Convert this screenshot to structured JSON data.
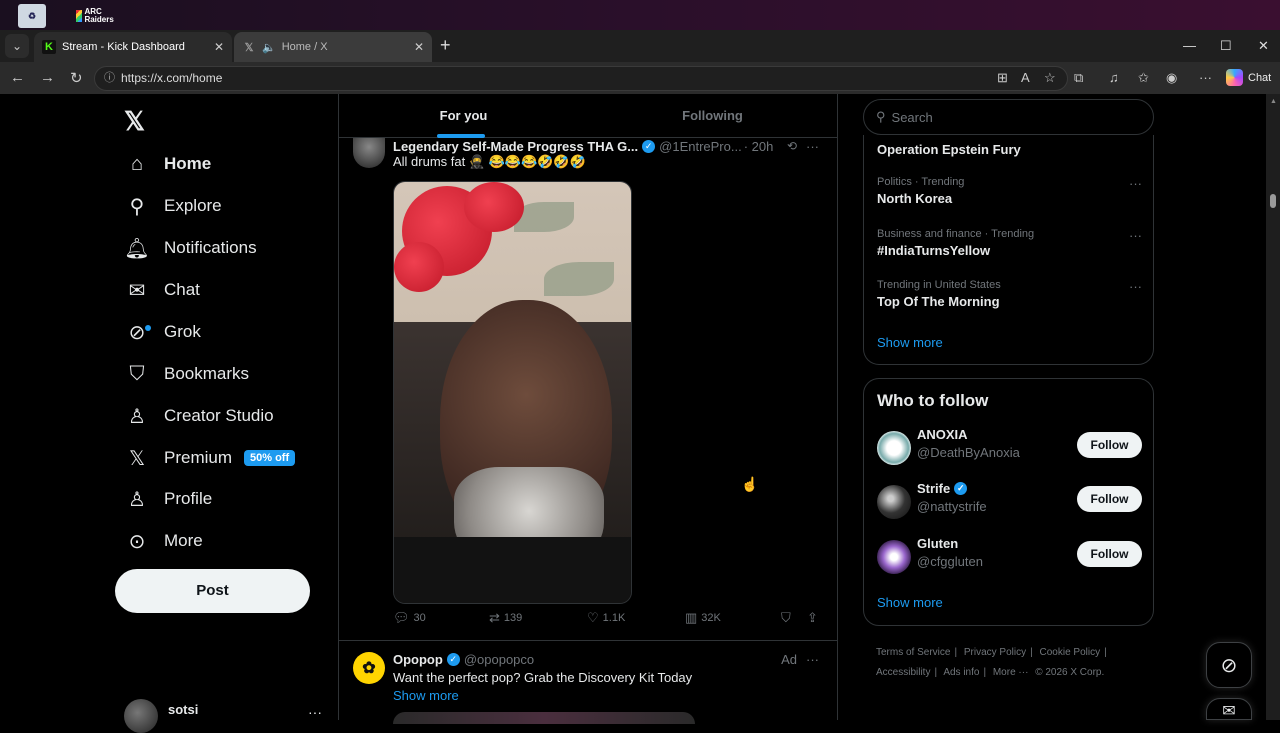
{
  "desktop": {
    "arc_label": "ARC Raiders"
  },
  "browser": {
    "tabs": [
      {
        "title": "Stream - Kick Dashboard",
        "favicon": "kick-icon"
      },
      {
        "title": "Home / X",
        "favicon": "x-icon"
      }
    ],
    "url": "https://x.com/home",
    "copilot_label": "Chat"
  },
  "nav": {
    "items": [
      {
        "label": "Home",
        "icon": "home-icon"
      },
      {
        "label": "Explore",
        "icon": "search-icon"
      },
      {
        "label": "Notifications",
        "icon": "bell-icon"
      },
      {
        "label": "Chat",
        "icon": "mail-icon"
      },
      {
        "label": "Grok",
        "icon": "grok-icon"
      },
      {
        "label": "Bookmarks",
        "icon": "bookmark-icon"
      },
      {
        "label": "Creator Studio",
        "icon": "creator-icon"
      },
      {
        "label": "Premium",
        "icon": "x-icon"
      },
      {
        "label": "Profile",
        "icon": "person-icon"
      },
      {
        "label": "More",
        "icon": "more-circle-icon"
      }
    ],
    "premium_badge": "50% off",
    "post_label": "Post",
    "account_name": "sotsi"
  },
  "feed": {
    "tabs": [
      "For you",
      "Following"
    ],
    "tweet": {
      "name": "Legendary Self-Made Progress THA G...",
      "handle": "@1EntrePro...",
      "time": "· 20h",
      "text": "All drums fat 🥷 😂😂😂🤣🤣🤣",
      "replies": "30",
      "reposts": "139",
      "likes": "1.1K",
      "views": "32K"
    },
    "ad": {
      "name": "Opopop",
      "handle": "@opopopco",
      "ad_label": "Ad",
      "text": "Want the perfect pop? Grab the Discovery Kit Today",
      "show_more": "Show more"
    }
  },
  "sidebar": {
    "search_placeholder": "Search",
    "trends": [
      {
        "context": "",
        "topic": "Operation Epstein Fury"
      },
      {
        "context": "Politics · Trending",
        "topic": "North Korea"
      },
      {
        "context": "Business and finance · Trending",
        "topic": "#IndiaTurnsYellow"
      },
      {
        "context": "Trending in United States",
        "topic": "Top Of The Morning"
      }
    ],
    "trends_show_more": "Show more",
    "who_to_follow": {
      "title": "Who to follow",
      "accounts": [
        {
          "name": "ANOXIA",
          "handle": "@DeathByAnoxia",
          "verified": false
        },
        {
          "name": "Strife",
          "handle": "@nattystrife",
          "verified": true
        },
        {
          "name": "Gluten",
          "handle": "@cfggluten",
          "verified": false
        }
      ],
      "follow_label": "Follow",
      "show_more": "Show more"
    },
    "footer": [
      "Terms of Service",
      "Privacy Policy",
      "Cookie Policy",
      "Accessibility",
      "Ads info",
      "More ···",
      "© 2026 X Corp."
    ]
  },
  "colors": {
    "accent": "#1d9bf0",
    "background": "#000000",
    "muted": "#71767b",
    "border": "#2f3336"
  }
}
